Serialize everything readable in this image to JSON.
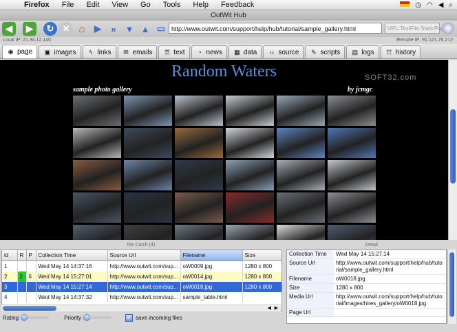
{
  "menubar": {
    "items": [
      "Firefox",
      "File",
      "Edit",
      "View",
      "Go",
      "Tools",
      "Help",
      "Feedback"
    ]
  },
  "window": {
    "title": "OutWit Hub"
  },
  "toolbar": {
    "url": "http://www.outwit.com/support/help/hub/tutorial/sample_gallery.html",
    "url_hint": "URL:TextFile.StaticPage"
  },
  "ipbar": {
    "local_ip": "Local IP: 21.34.12.140",
    "remote_ip": "Remote IP: 91.121.76.212"
  },
  "tabs": [
    {
      "label": "page",
      "icon": "globe-icon",
      "glyph": "◉"
    },
    {
      "label": "images",
      "icon": "image-icon",
      "glyph": "▣"
    },
    {
      "label": "links",
      "icon": "lightning-icon",
      "glyph": "ϟ"
    },
    {
      "label": "emails",
      "icon": "envelope-icon",
      "glyph": "✉"
    },
    {
      "label": "text",
      "icon": "document-icon",
      "glyph": "☰"
    },
    {
      "label": "news",
      "icon": "rss-icon",
      "glyph": "◔"
    },
    {
      "label": "data",
      "icon": "table-icon",
      "glyph": "▦"
    },
    {
      "label": "source",
      "icon": "code-icon",
      "glyph": "‹›"
    },
    {
      "label": "scripts",
      "icon": "script-icon",
      "glyph": "✎"
    },
    {
      "label": "logs",
      "icon": "log-icon",
      "glyph": "▤"
    },
    {
      "label": "history",
      "icon": "history-icon",
      "glyph": "☷"
    }
  ],
  "gallery": {
    "title": "Random Waters",
    "subtitle": "sample photo gallery",
    "byline": "by jcmgc",
    "watermark": "SOFT32.com",
    "thumb_colors": [
      [
        "#6b6f73",
        "#7d96b2",
        "#b9c3cc",
        "#c6ccd3",
        "#9aa8b8",
        "#8c8f93"
      ],
      [
        "#b7b9bb",
        "#3c4b5e",
        "#9a6b3a",
        "#d3d8de",
        "#5d86c4",
        "#4f77b8"
      ],
      [
        "#8a5a3e",
        "#6a86a8",
        "#2f3a4a",
        "#8aa0b8",
        "#a6aeb6",
        "#c3c8cd"
      ],
      [
        "#4a5666",
        "#2a3444",
        "#7c5a4c",
        "#8a2a2a",
        "#6a7078",
        "#8c8f94"
      ],
      [
        "#50606e",
        "#3e3e40",
        "#6d7785",
        "#9ba6b2",
        "#d9dbde",
        "#4d5e73"
      ]
    ]
  },
  "catch": {
    "label": "the Catch (4)",
    "columns": [
      "id",
      "R",
      "P",
      "Collection Time",
      "Source Url",
      "Filename",
      "Size"
    ],
    "rows": [
      {
        "id": "1",
        "r": "",
        "p": "",
        "time": "Wed May 14 14:37:16",
        "url": "http://www.outwit.com/sup...",
        "file": "oW0009.jpg",
        "size": "1280 x 800"
      },
      {
        "id": "2",
        "r": "2",
        "p": "6",
        "time": "Wed May 14 15:27:01",
        "url": "http://www.outwit.com/sup...",
        "file": "oW0014.jpg",
        "size": "1280 x 800"
      },
      {
        "id": "3",
        "r": "",
        "p": "",
        "time": "Wed May 14 15:27:14",
        "url": "http://www.outwit.com/sup...",
        "file": "oW0018.jpg",
        "size": "1280 x 800"
      },
      {
        "id": "4",
        "r": "",
        "p": "",
        "time": "Wed May 14 14:37:32",
        "url": "http://www.outwit.com/sup...",
        "file": "sample_table.html",
        "size": ""
      }
    ],
    "selected_row": 2
  },
  "controls": {
    "rating_label": "Rating",
    "priority_label": "Priority",
    "save_label": "save incoming files"
  },
  "detail": {
    "label": "Detail",
    "rows": [
      {
        "key": "Collection Time",
        "value": "Wed May 14 15:27:14"
      },
      {
        "key": "Source Url",
        "value": "http://www.outwit.com/support/help/hub/tutorial/sample_gallery.html"
      },
      {
        "key": "Filename",
        "value": "oW0018.jpg"
      },
      {
        "key": "Size",
        "value": "1280 x 800"
      },
      {
        "key": "Media Url",
        "value": "http://www.outwit.com/support/help/hub/tutorial/images/hires_gallery/oW0018.jpg"
      },
      {
        "key": "Page Url",
        "value": ""
      }
    ]
  },
  "colors": {
    "accent": "#3168d6",
    "gallery_title": "#5a8fd8",
    "highlight_yellow": "#fdfbc6",
    "rating_green": "#2ec42e"
  }
}
